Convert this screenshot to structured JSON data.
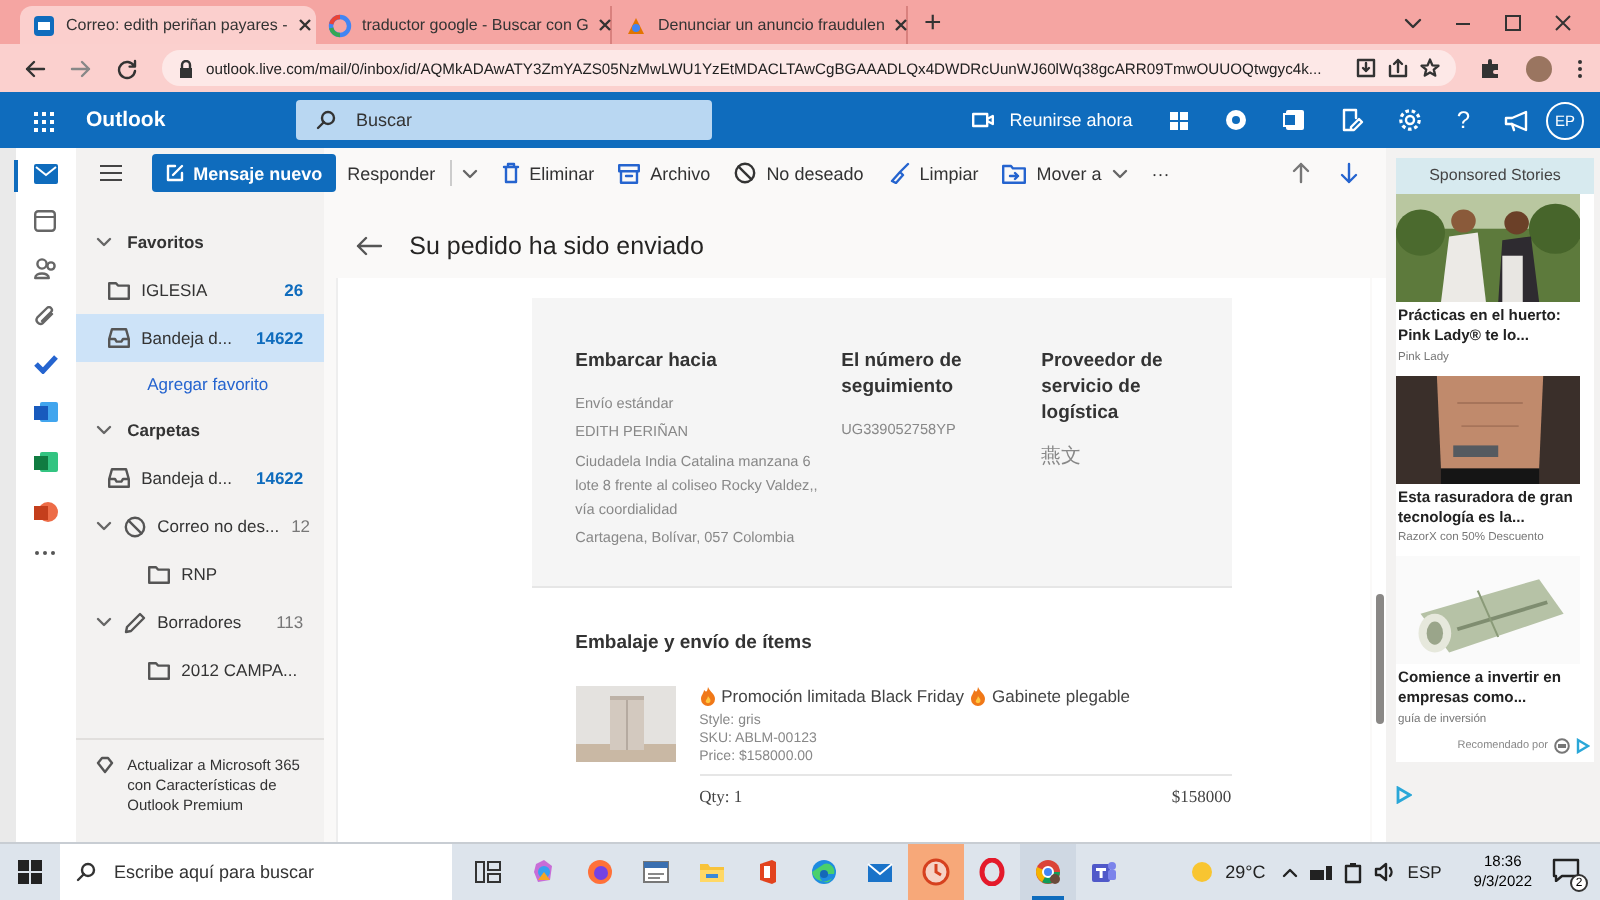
{
  "browser": {
    "tabs": [
      {
        "title": "Correo: edith periñan payares - ",
        "selected": true
      },
      {
        "title": "traductor google - Buscar con G",
        "selected": false
      },
      {
        "title": "Denunciar un anuncio fraudulen",
        "selected": false
      }
    ],
    "new_tab": "+",
    "url": "outlook.live.com/mail/0/inbox/id/AQMkADAwATY3ZmYAZS05NzMwLWU1YzEtMDACLTAwCgBGAAADLQx4DWDRcUunWJ60lWq38gcARR09TmwOUUOQtwgyc4k..."
  },
  "header": {
    "app_name": "Outlook",
    "search_placeholder": "Buscar",
    "meet_now": "Reunirse ahora",
    "help": "?",
    "avatar": "EP"
  },
  "new_message": "Mensaje nuevo",
  "commands": [
    {
      "label": "Responder",
      "kind": "reply"
    },
    {
      "label": "Eliminar",
      "kind": "delete"
    },
    {
      "label": "Archivo",
      "kind": "archive"
    },
    {
      "label": "No deseado",
      "kind": "junk"
    },
    {
      "label": "Limpiar",
      "kind": "sweep"
    },
    {
      "label": "Mover a",
      "kind": "move"
    },
    {
      "label": "···",
      "kind": "more"
    }
  ],
  "folders": [
    {
      "label": "Favoritos",
      "expanded": true,
      "items": [
        {
          "name": "IGLESIA",
          "kind": "folder",
          "count": "26",
          "unread": true,
          "selected": false
        },
        {
          "name": "Bandeja d...",
          "kind": "inbox",
          "count": "14622",
          "unread": true,
          "selected": true
        }
      ],
      "link": "Agregar favorito"
    },
    {
      "label": "Carpetas",
      "expanded": true,
      "items": [
        {
          "name": "Bandeja d...",
          "kind": "inbox",
          "count": "14622",
          "unread": true,
          "selected": false
        },
        {
          "name": "Correo no des...",
          "kind": "junk",
          "count": "12",
          "unread": false,
          "selected": false,
          "expanded": true,
          "children": [
            {
              "name": "RNP",
              "kind": "folder",
              "selected": false
            }
          ]
        },
        {
          "name": "Borradores",
          "kind": "drafts",
          "count": "113",
          "unread": false,
          "selected": false,
          "expanded": true,
          "children": [
            {
              "name": "2012 CAMPA...",
              "kind": "folder",
              "selected": false
            }
          ]
        }
      ]
    }
  ],
  "upgrade": "Actualizar a Microsoft 365 con Características de Outlook Premium",
  "message": {
    "subject": "Su pedido ha sido enviado",
    "ship_to": {
      "heading": "Embarcar hacia",
      "lines": [
        "Envío estándar",
        "EDITH PERIÑAN",
        "Ciudadela India Catalina manzana 6 lote 8 frente al coliseo Rocky Valdez,, vía coordialidad",
        "Cartagena, Bolívar, 057 Colombia"
      ]
    },
    "tracking": {
      "heading": "El número de seguimiento",
      "value": "UG339052758YP"
    },
    "provider": {
      "heading": "Proveedor de servicio de logística",
      "value": "燕文"
    },
    "items_heading": "Embalaje y envío de ítems",
    "item": {
      "promo": "Promoción limitada Black Friday",
      "name": "Gabinete plegable",
      "style": "Style: gris",
      "sku": "SKU: ABLM-00123",
      "price": "Price: $158000.00",
      "qty": "Qty: 1",
      "total": "$158000"
    }
  },
  "ads": {
    "heading": "Sponsored Stories",
    "stories": [
      {
        "title": "Prácticas en el huerto: Pink Lady® te lo...",
        "source": "Pink Lady"
      },
      {
        "title": "Esta rasuradora de gran tecnología es la...",
        "source": "RazorX con 50% Descuento"
      },
      {
        "title": "Comience a invertir en empresas como...",
        "source": "guía de inversión"
      }
    ],
    "recommended": "Recomendado por"
  },
  "taskbar": {
    "search_placeholder": "Escribe aquí para buscar",
    "apps": [
      {
        "open": false,
        "attention": false
      },
      {
        "open": false,
        "attention": false
      },
      {
        "open": false,
        "attention": false
      },
      {
        "open": false,
        "attention": false
      },
      {
        "open": false,
        "attention": false
      },
      {
        "open": false,
        "attention": false
      },
      {
        "open": false,
        "attention": false
      },
      {
        "open": false,
        "attention": false
      },
      {
        "open": false,
        "attention": true
      },
      {
        "open": false,
        "attention": false
      },
      {
        "open": true,
        "attention": false
      },
      {
        "open": false,
        "attention": false
      }
    ],
    "weather": "29°C",
    "language": "ESP",
    "time": "18:36",
    "date": "9/3/2022",
    "notifications": "2"
  }
}
